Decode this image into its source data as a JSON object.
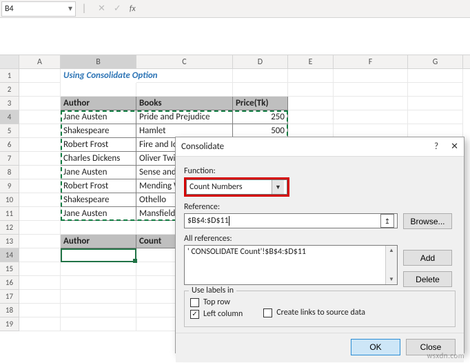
{
  "nameBox": "B4",
  "title": "Using Consolidate Option",
  "columns": [
    "A",
    "B",
    "C",
    "D",
    "E",
    "F",
    "G"
  ],
  "rows": [
    "1",
    "2",
    "3",
    "4",
    "5",
    "6",
    "7",
    "8",
    "9",
    "10",
    "11",
    "12",
    "13",
    "14",
    "15",
    "16",
    "17",
    "18",
    "19"
  ],
  "table": {
    "headers": {
      "author": "Author",
      "books": "Books",
      "price": "Price(Tk)"
    },
    "data": [
      {
        "author": "Jane Austen",
        "book": "Pride and Prejudice",
        "price": "250"
      },
      {
        "author": "Shakespeare",
        "book": "Hamlet",
        "price": "500"
      },
      {
        "author": "Robert Frost",
        "book": "Fire and Ice",
        "price": ""
      },
      {
        "author": "Charles Dickens",
        "book": "Oliver Twist",
        "price": ""
      },
      {
        "author": "Jane Austen",
        "book": "Sense and Sensibility",
        "price": ""
      },
      {
        "author": "Robert Frost",
        "book": "Mending Wall",
        "price": ""
      },
      {
        "author": "Shakespeare",
        "book": "Othello",
        "price": ""
      },
      {
        "author": "Jane Austen",
        "book": "Mansfield Park",
        "price": ""
      }
    ]
  },
  "destHeaders": {
    "author": "Author",
    "count": "Count"
  },
  "dialog": {
    "title": "Consolidate",
    "help": "?",
    "close": "✕",
    "functionLabel": "Function:",
    "functionValue": "Count Numbers",
    "referenceLabel": "Reference:",
    "referenceValue": "$B$4:$D$11",
    "allRefsLabel": "All references:",
    "allRefsItem": "' CONSOLIDATE Count'!$B$4:$D$11",
    "browse": "Browse...",
    "add": "Add",
    "delete": "Delete",
    "groupTitle": "Use labels in",
    "topRow": "Top row",
    "leftCol": "Left column",
    "createLinks": "Create links to source data",
    "ok": "OK",
    "closeBtn": "Close"
  },
  "watermark": "wsxdn.com"
}
